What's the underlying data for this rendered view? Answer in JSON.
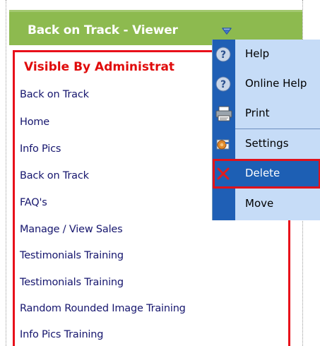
{
  "module": {
    "title": "Back on Track - Viewer",
    "panel_header": "Visible By Administrat",
    "links": [
      "Back on Track",
      "Home",
      "Info Pics",
      "Back on Track",
      "FAQ's",
      "Manage / View Sales",
      "Testimonials Training",
      "Testimonials Training",
      "Random Rounded Image Training",
      "Info Pics Training"
    ]
  },
  "context_menu": {
    "items": [
      {
        "label": "Help",
        "icon": "help-icon"
      },
      {
        "label": "Online Help",
        "icon": "online-help-icon"
      },
      {
        "label": "Print",
        "icon": "printer-icon"
      },
      {
        "label": "Settings",
        "icon": "settings-icon"
      },
      {
        "label": "Delete",
        "icon": "delete-x-icon",
        "selected": true
      },
      {
        "label": "Move",
        "icon": ""
      }
    ]
  },
  "colors": {
    "title_bar": "#8dba4f",
    "panel_border": "#e8101a",
    "header_text": "#e00b0b",
    "link_text": "#16166e",
    "menu_background": "#c6dcf7",
    "menu_gutter": "#1f5fb5",
    "selected_outline": "#e0121a"
  }
}
